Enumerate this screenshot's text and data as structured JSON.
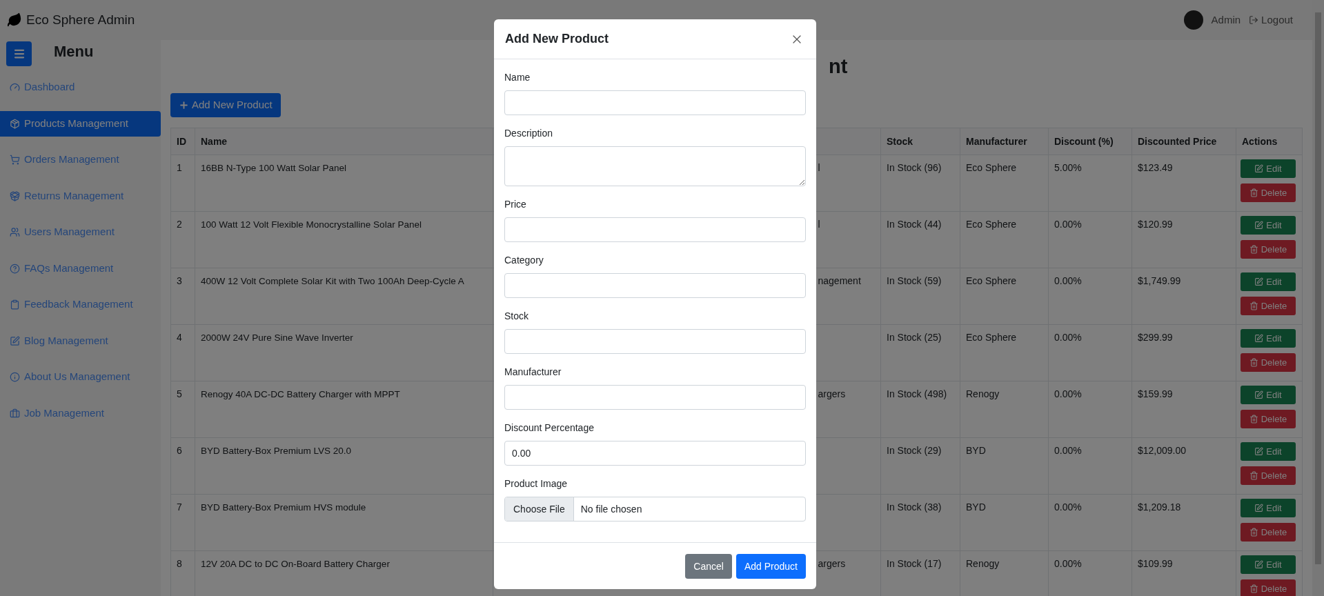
{
  "app": {
    "brand": "Eco Sphere Admin",
    "menu_title": "Menu"
  },
  "user": {
    "name": "Admin",
    "logout": "Logout"
  },
  "sidebar": {
    "items": [
      {
        "label": "Dashboard",
        "selected": false
      },
      {
        "label": "Products Management",
        "selected": true
      },
      {
        "label": "Orders Management",
        "selected": false
      },
      {
        "label": "Returns Management",
        "selected": false
      },
      {
        "label": "Users Management",
        "selected": false
      },
      {
        "label": "FAQs Management",
        "selected": false
      },
      {
        "label": "Feedback Management",
        "selected": false
      },
      {
        "label": "Blog Management",
        "selected": false
      },
      {
        "label": "About Us Management",
        "selected": false
      },
      {
        "label": "Job Management",
        "selected": false
      }
    ]
  },
  "page": {
    "heading_fragment": "nt",
    "add_button": "Add New Product"
  },
  "table": {
    "columns": [
      "ID",
      "Name",
      "Stock",
      "Manufacturer",
      "Discount (%)",
      "Discounted Price",
      "Actions"
    ],
    "rows": [
      {
        "id": "1",
        "name": "16BB N-Type 100 Watt Solar Panel",
        "column_3": "l",
        "stock": "In Stock (96)",
        "manufacturer": "Eco Sphere",
        "discount": "5.00%",
        "discounted_price": "$123.49",
        "actions": [
          "Edit",
          "Delete"
        ]
      },
      {
        "id": "2",
        "name": "100 Watt 12 Volt Flexible Monocrystalline Solar Panel",
        "column_3": "l",
        "stock": "In Stock (44)",
        "manufacturer": "Eco Sphere",
        "discount": "0.00%",
        "discounted_price": "$120.99",
        "actions": [
          "Edit",
          "Delete"
        ]
      },
      {
        "id": "3",
        "name": "400W 12 Volt Complete Solar Kit with Two 100Ah Deep-Cycle A",
        "column_3": "nagement",
        "stock": "In Stock (59)",
        "manufacturer": "Eco Sphere",
        "discount": "0.00%",
        "discounted_price": "$1,749.99",
        "actions": [
          "Edit",
          "Delete"
        ]
      },
      {
        "id": "4",
        "name": "2000W 24V Pure Sine Wave Inverter",
        "stock": "In Stock (25)",
        "manufacturer": "Eco Sphere",
        "discount": "0.00%",
        "discounted_price": "$299.99",
        "actions": [
          "Edit",
          "Delete"
        ]
      },
      {
        "id": "5",
        "name": "Renogy 40A DC-DC Battery Charger with MPPT",
        "column_3": "argers",
        "stock": "In Stock (498)",
        "manufacturer": "Renogy",
        "discount": "0.00%",
        "discounted_price": "$159.99",
        "actions": [
          "Edit",
          "Delete"
        ]
      },
      {
        "id": "6",
        "name": "BYD Battery-Box Premium LVS 20.0",
        "stock": "In Stock (29)",
        "manufacturer": "BYD",
        "discount": "0.00%",
        "discounted_price": "$12,009.00",
        "actions": [
          "Edit",
          "Delete"
        ]
      },
      {
        "id": "7",
        "name": "BYD Battery-Box Premium HVS module",
        "stock": "In Stock (38)",
        "manufacturer": "BYD",
        "discount": "0.00%",
        "discounted_price": "$1,209.18",
        "actions": [
          "Edit",
          "Delete"
        ]
      },
      {
        "id": "8",
        "name": "12V 20A DC to DC On-Board Battery Charger",
        "column_3": "argers",
        "stock": "In Stock (17)",
        "manufacturer": "Renogy",
        "discount": "0.00%",
        "discounted_price": "$109.99",
        "actions": [
          "Edit",
          "Delete"
        ]
      }
    ]
  },
  "modal": {
    "title": "Add New Product",
    "fields": [
      {
        "label": "Name",
        "kind": "text"
      },
      {
        "label": "Description",
        "kind": "textarea"
      },
      {
        "label": "Price",
        "kind": "text"
      },
      {
        "label": "Category",
        "kind": "text"
      },
      {
        "label": "Stock",
        "kind": "text"
      },
      {
        "label": "Manufacturer",
        "kind": "text"
      },
      {
        "label": "Discount Percentage",
        "kind": "text",
        "value": "0.00"
      },
      {
        "label": "Product Image",
        "kind": "file",
        "button": "Choose File",
        "status": "No file chosen"
      }
    ],
    "buttons": [
      {
        "label": "Cancel",
        "kind": "secondary"
      },
      {
        "label": "Add Product",
        "kind": "primary"
      }
    ]
  }
}
